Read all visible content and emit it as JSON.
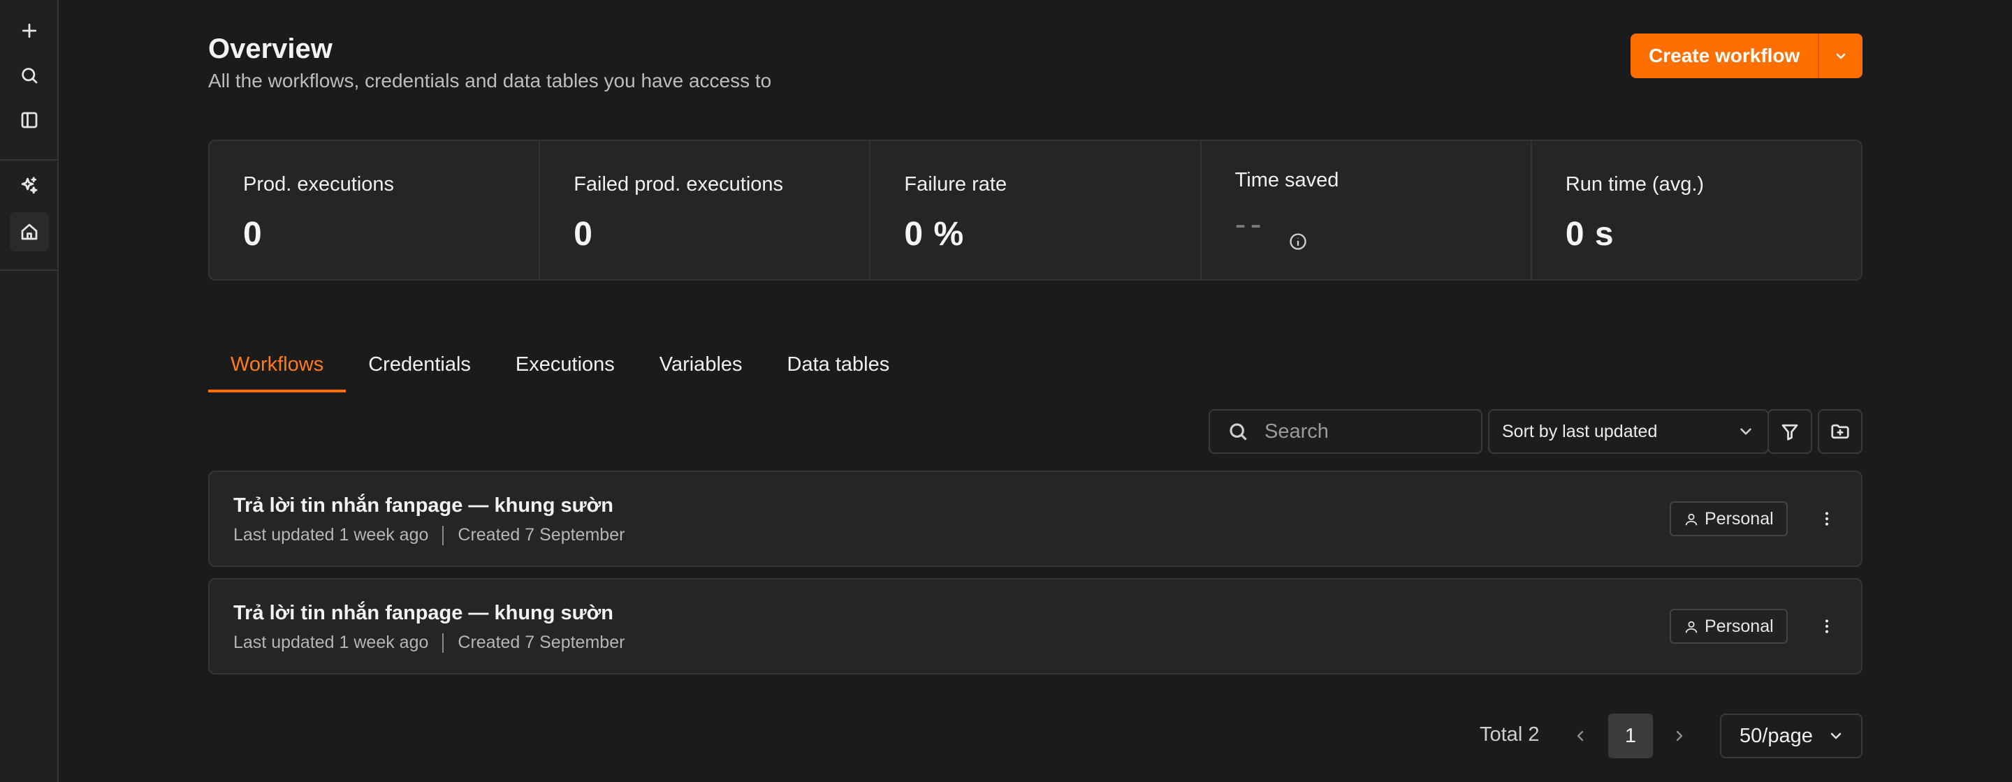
{
  "sidebar": {
    "icons": [
      "plus-icon",
      "search-icon",
      "panel-toggle-icon",
      "sparkles-icon",
      "home-icon"
    ]
  },
  "header": {
    "title": "Overview",
    "subtitle": "All the workflows, credentials and data tables you have access to",
    "create_label": "Create workflow"
  },
  "stats": [
    {
      "label": "Prod. executions",
      "value": "0"
    },
    {
      "label": "Failed prod. executions",
      "value": "0"
    },
    {
      "label": "Failure rate",
      "value": "0 %"
    },
    {
      "label": "Time saved",
      "value": "--"
    },
    {
      "label": "Run time (avg.)",
      "value": "0 s"
    }
  ],
  "tabs": [
    {
      "label": "Workflows",
      "active": true
    },
    {
      "label": "Credentials"
    },
    {
      "label": "Executions"
    },
    {
      "label": "Variables"
    },
    {
      "label": "Data tables"
    }
  ],
  "toolbar": {
    "search_placeholder": "Search",
    "sort_label": "Sort by last updated"
  },
  "workflows": [
    {
      "name": "Trả lời tin nhắn fanpage — khung sườn",
      "updated": "Last updated 1 week ago",
      "created": "Created 7 September",
      "owner": "Personal"
    },
    {
      "name": "Trả lời tin nhắn fanpage — khung sườn",
      "updated": "Last updated 1 week ago",
      "created": "Created 7 September",
      "owner": "Personal"
    }
  ],
  "pagination": {
    "total": "Total 2",
    "current_page": "1",
    "page_size": "50/page"
  },
  "colors": {
    "accent": "#ff6f00",
    "background": "#1b1b1b",
    "card": "#252525"
  }
}
